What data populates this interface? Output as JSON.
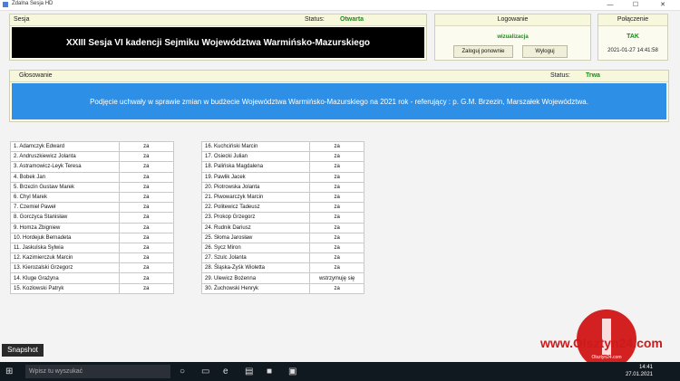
{
  "window": {
    "title": "Zdalna Sesja HD"
  },
  "session": {
    "label": "Sesja",
    "status_label": "Status:",
    "status_value": "Otwarta",
    "title": "XXIII Sesja VI kadencji Sejmiku Województwa Warmińsko-Mazurskiego"
  },
  "login": {
    "label": "Logowanie",
    "mode": "wizualizacja",
    "relogin_label": "Zaloguj ponownie",
    "logout_label": "Wyloguj"
  },
  "connection": {
    "label": "Połączenie",
    "status": "TAK",
    "timestamp": "2021-01-27 14:41:58"
  },
  "voting": {
    "label": "Głosowanie",
    "status_label": "Status:",
    "status_value": "Trwa",
    "subject": "Podjęcie uchwały w sprawie zmian w budżecie Województwa Warmińsko-Mazurskiego na 2021 rok - referujący : p. G.M. Brzezin, Marszałek Województwa."
  },
  "votes_left": [
    {
      "name": "1. Adamczyk Edward",
      "vote": "za"
    },
    {
      "name": "2. Andruszkiewicz Jolanta",
      "vote": "za"
    },
    {
      "name": "3. Astramowicz-Leyk Teresa",
      "vote": "za"
    },
    {
      "name": "4. Bobek Jan",
      "vote": "za"
    },
    {
      "name": "5. Brzezin Gustaw Marek",
      "vote": "za"
    },
    {
      "name": "6. Chyl Marek",
      "vote": "za"
    },
    {
      "name": "7. Czemiel Paweł",
      "vote": "za"
    },
    {
      "name": "8. Gorczyca Stanisław",
      "vote": "za"
    },
    {
      "name": "9. Homza Zbigniew",
      "vote": "za"
    },
    {
      "name": "10. Hordejuk Bernadeta",
      "vote": "za"
    },
    {
      "name": "11. Jaskulska Sylwia",
      "vote": "za"
    },
    {
      "name": "12. Kazimierczuk Marcin",
      "vote": "za"
    },
    {
      "name": "13. Kierozalski Grzegorz",
      "vote": "za"
    },
    {
      "name": "14. Kluge Grażyna",
      "vote": "za"
    },
    {
      "name": "15. Kozłowski Patryk",
      "vote": "za"
    }
  ],
  "votes_right": [
    {
      "name": "16. Kuchciński Marcin",
      "vote": "za"
    },
    {
      "name": "17. Osiecki Julian",
      "vote": "za"
    },
    {
      "name": "18. Palińska Magdalena",
      "vote": "za"
    },
    {
      "name": "19. Pawlik Jacek",
      "vote": "za"
    },
    {
      "name": "20. Piotrowska Jolanta",
      "vote": "za"
    },
    {
      "name": "21. Piwowarczyk Marcin",
      "vote": "za"
    },
    {
      "name": "22. Politewicz Tadeusz",
      "vote": "za"
    },
    {
      "name": "23. Prokop Grzegorz",
      "vote": "za"
    },
    {
      "name": "24. Rudnik Dariusz",
      "vote": "za"
    },
    {
      "name": "25. Słoma Jarosław",
      "vote": "za"
    },
    {
      "name": "26. Sycz Miron",
      "vote": "za"
    },
    {
      "name": "27. Szulc Jolanta",
      "vote": "za"
    },
    {
      "name": "28. Śląska-Zyśk Wioletta",
      "vote": "za"
    },
    {
      "name": "29. Ulewicz Bożenna",
      "vote": "wstrzymuję się"
    },
    {
      "name": "30. Żuchowski Henryk",
      "vote": "za"
    }
  ],
  "snapshot_label": "Snapshot",
  "watermark": {
    "text": "www.Olsztyn24.com",
    "sub": "Olsztyn24.com"
  },
  "taskbar": {
    "search_placeholder": "Wpisz tu wyszukać",
    "time": "14:41",
    "date": "27.01.2021"
  }
}
